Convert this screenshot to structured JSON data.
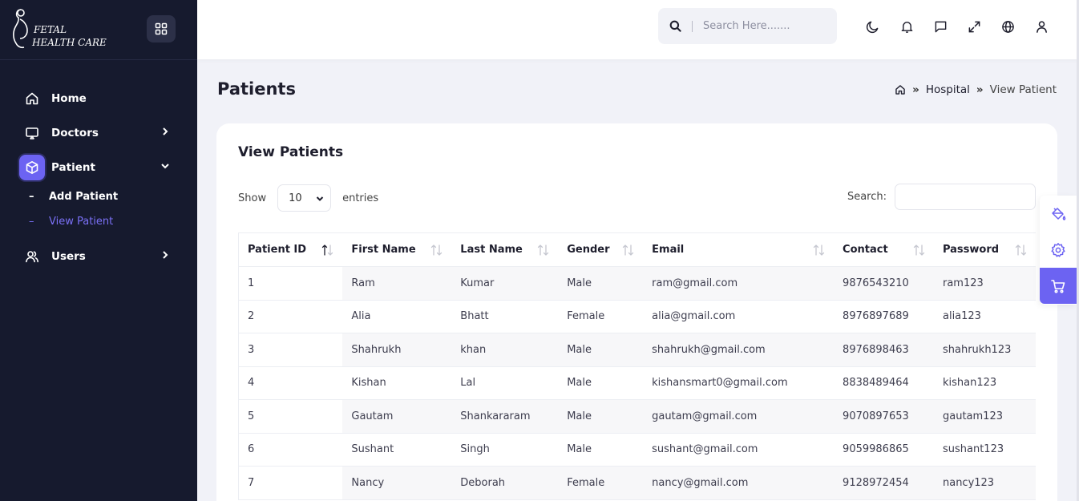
{
  "brand": {
    "line1": "FETAL",
    "line2": "HEALTH CARE"
  },
  "sidebar": {
    "items": [
      {
        "label": "Home",
        "icon": "home-icon"
      },
      {
        "label": "Doctors",
        "icon": "monitor-icon"
      },
      {
        "label": "Patient",
        "icon": "box-icon"
      },
      {
        "label": "Users",
        "icon": "users-icon"
      }
    ],
    "patient_sub": [
      {
        "dash": "–",
        "label": "Add Patient"
      },
      {
        "dash": "–",
        "label": "View Patient"
      }
    ]
  },
  "header": {
    "search_placeholder": "Search Here......."
  },
  "page": {
    "title": "Patients",
    "breadcrumb": {
      "sep": "»",
      "item1": "Hospital",
      "item2": "View Patient"
    }
  },
  "card": {
    "title": "View Patients",
    "show_label": "Show",
    "entries_value": "10",
    "entries_label": "entries",
    "search_label": "Search:"
  },
  "table": {
    "headers": [
      "Patient ID",
      "First Name",
      "Last Name",
      "Gender",
      "Email",
      "Contact",
      "Password"
    ],
    "rows": [
      [
        "1",
        "Ram",
        "Kumar",
        "Male",
        "ram@gmail.com",
        "9876543210",
        "ram123"
      ],
      [
        "2",
        "Alia",
        "Bhatt",
        "Female",
        "alia@gmail.com",
        "8976897689",
        "alia123"
      ],
      [
        "3",
        "Shahrukh",
        "khan",
        "Male",
        "shahrukh@gmail.com",
        "8976898463",
        "shahrukh123"
      ],
      [
        "4",
        "Kishan",
        "Lal",
        "Male",
        "kishansmart0@gmail.com",
        "8838489464",
        "kishan123"
      ],
      [
        "5",
        "Gautam",
        "Shankararam",
        "Male",
        "gautam@gmail.com",
        "9070897653",
        "gautam123"
      ],
      [
        "6",
        "Sushant",
        "Singh",
        "Male",
        "sushant@gmail.com",
        "9059986865",
        "sushant123"
      ],
      [
        "7",
        "Nancy",
        "Deborah",
        "Female",
        "nancy@gmail.com",
        "9128972454",
        "nancy123"
      ]
    ]
  },
  "colors": {
    "sidebar_bg": "#161a2e",
    "accent": "#6c63f2",
    "page_bg": "#f1f2f8"
  }
}
